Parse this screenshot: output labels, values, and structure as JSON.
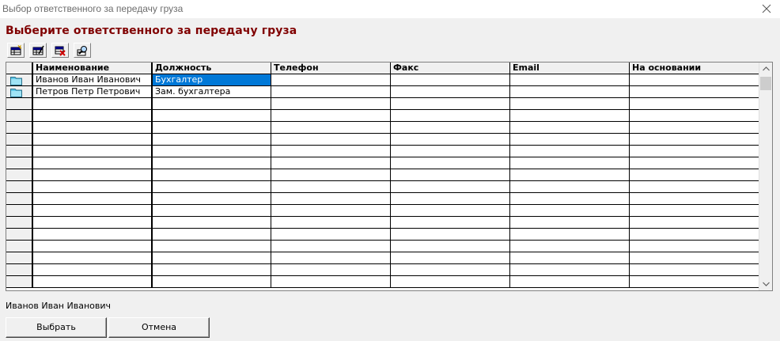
{
  "window": {
    "title": "Выбор ответственного за передачу груза"
  },
  "heading": "Выберите ответственного за передачу груза",
  "toolbar": {
    "buttons": [
      {
        "name": "add-record",
        "icon": "grid-add-icon"
      },
      {
        "name": "edit-record",
        "icon": "grid-edit-icon"
      },
      {
        "name": "delete-record",
        "icon": "grid-delete-icon"
      },
      {
        "name": "find-record",
        "icon": "search-icon"
      }
    ]
  },
  "table": {
    "columns": [
      "Наименование",
      "Должность",
      "Телефон",
      "Факс",
      "Email",
      "На основании"
    ],
    "rows": [
      {
        "name": "Иванов Иван Иванович",
        "position": "Бухгалтер",
        "phone": "",
        "fax": "",
        "email": "",
        "basis": ""
      },
      {
        "name": "Петров Петр Петрович",
        "position": "Зам. бухгалтера",
        "phone": "",
        "fax": "",
        "email": "",
        "basis": ""
      }
    ],
    "selected_row": 0,
    "selected_column": "position",
    "empty_row_count": 16
  },
  "status": {
    "selected_name": "Иванов Иван Иванович"
  },
  "buttons": {
    "select_label": "Выбрать",
    "cancel_label": "Отмена"
  },
  "colors": {
    "heading": "#800000",
    "selection": "#0078d7",
    "background": "#f0f0f0"
  }
}
